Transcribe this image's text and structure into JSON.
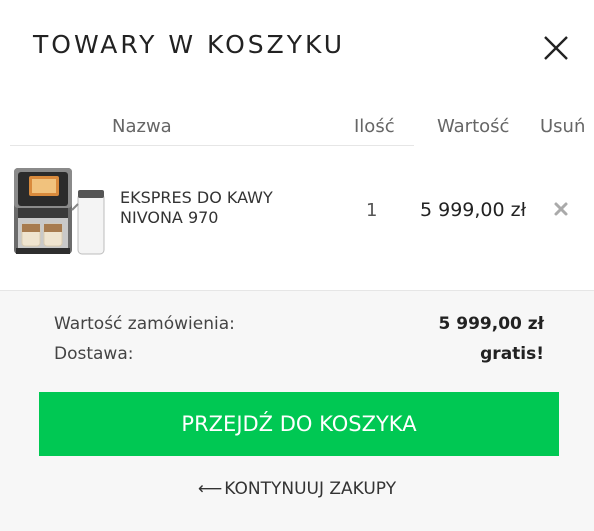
{
  "header": {
    "title": "TOWARY W KOSZYKU",
    "close_icon": "close-icon"
  },
  "table": {
    "columns": [
      "Nazwa",
      "Ilość",
      "Wartość",
      "Usuń"
    ]
  },
  "items": [
    {
      "name": "EKSPRES DO KAWY NIVONA 970",
      "quantity": "1",
      "price": "5 999,00 zł",
      "image_icon": "coffee-machine-image",
      "remove_icon": "remove-icon"
    }
  ],
  "summary": {
    "order_value_label": "Wartość zamówienia:",
    "order_value": "5 999,00 zł",
    "delivery_label": "Dostawa:",
    "delivery_value": "gratis!"
  },
  "actions": {
    "checkout_label": "PRZEJDŹ DO KOSZYKA",
    "continue_arrow": "⟵",
    "continue_label": "KONTYNUUJ ZAKUPY"
  },
  "colors": {
    "accent": "#00c853",
    "summary_bg": "#f7f7f7"
  }
}
